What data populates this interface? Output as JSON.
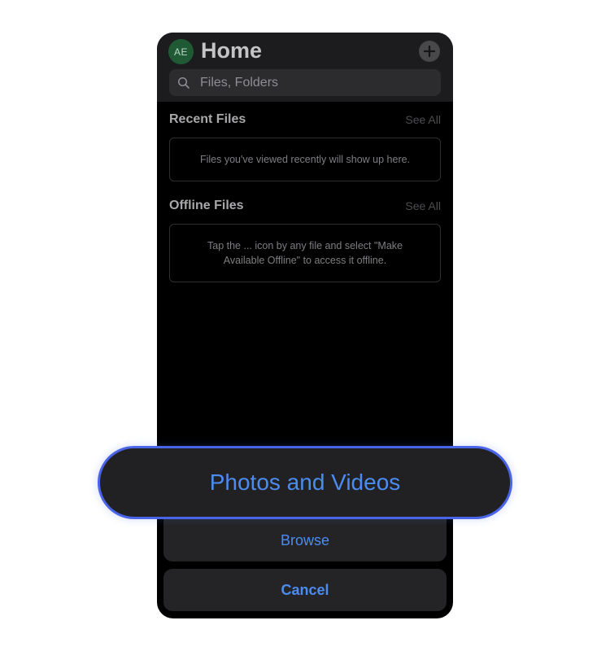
{
  "header": {
    "avatar_initials": "AE",
    "title": "Home",
    "add_icon": "plus-icon"
  },
  "search": {
    "placeholder": "Files, Folders",
    "icon": "search-icon"
  },
  "recent": {
    "title": "Recent Files",
    "see_all": "See All",
    "empty_text": "Files you've viewed recently will show up here."
  },
  "offline": {
    "title": "Offline Files",
    "see_all": "See All",
    "empty_line1": "Tap the ... icon by any file and select \"Make",
    "empty_line2": "Available Offline\" to access it offline."
  },
  "action_sheet": {
    "photos_label": "Photos and Videos",
    "browse_label": "Browse",
    "cancel_label": "Cancel"
  },
  "colors": {
    "accent": "#4c8cf0",
    "highlight_border": "#4a64e8",
    "avatar_bg": "#1f5a34"
  }
}
